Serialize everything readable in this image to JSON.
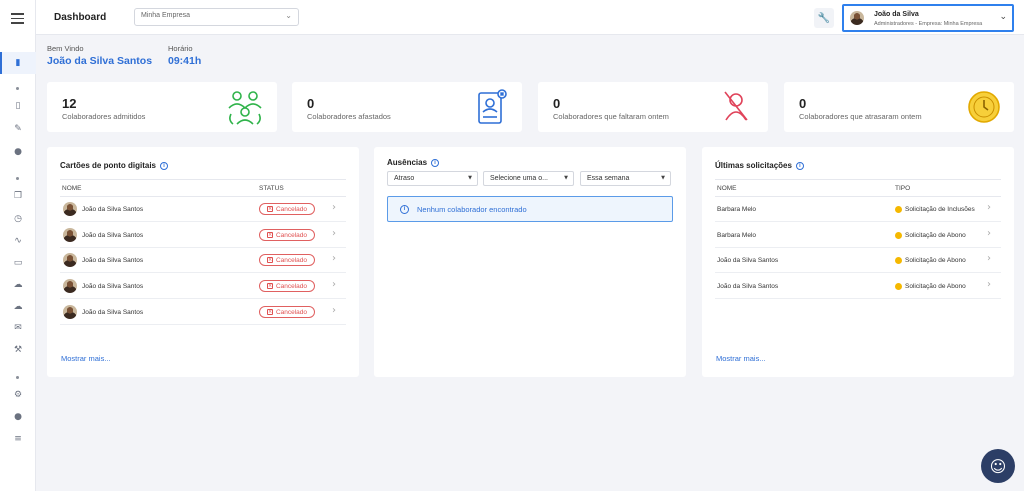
{
  "header": {
    "title": "Dashboard",
    "company_value": "Minha Empresa",
    "user": {
      "name": "João da Silva",
      "role": "Administradores - Empresa: Minha Empresa"
    }
  },
  "welcome": {
    "label": "Bem Vindo",
    "name": "João da Silva Santos",
    "hour_label": "Horário",
    "hour": "09:41h"
  },
  "stats": [
    {
      "value": "12",
      "label": "Colaboradores admitidos",
      "icon": "team-icon"
    },
    {
      "value": "0",
      "label": "Colaboradores afastados",
      "icon": "id-badge-icon"
    },
    {
      "value": "0",
      "label": "Colaboradores que faltaram ontem",
      "icon": "user-remove-icon"
    },
    {
      "value": "0",
      "label": "Colaboradores que atrasaram ontem",
      "icon": "clock-icon"
    }
  ],
  "timecards": {
    "title": "Cartões de ponto digitais",
    "col_name": "NOME",
    "col_status": "STATUS",
    "rows": [
      {
        "name": "João da Silva Santos",
        "status": "Cancelado"
      },
      {
        "name": "João da Silva Santos",
        "status": "Cancelado"
      },
      {
        "name": "João da Silva Santos",
        "status": "Cancelado"
      },
      {
        "name": "João da Silva Santos",
        "status": "Cancelado"
      },
      {
        "name": "João da Silva Santos",
        "status": "Cancelado"
      }
    ],
    "more": "Mostrar mais..."
  },
  "absences": {
    "title": "Ausências",
    "filter_type": "Atraso",
    "filter_option": "Selecione uma o...",
    "filter_period": "Essa semana",
    "empty": "Nenhum colaborador encontrado"
  },
  "requests": {
    "title": "Últimas solicitações",
    "col_name": "NOME",
    "col_type": "TIPO",
    "rows": [
      {
        "name": "Barbara Melo",
        "type": "Solicitação de Inclusões"
      },
      {
        "name": "Barbara Melo",
        "type": "Solicitação de Abono"
      },
      {
        "name": "João da Silva Santos",
        "type": "Solicitação de Abono"
      },
      {
        "name": "João da Silva Santos",
        "type": "Solicitação de Abono"
      }
    ],
    "more": "Mostrar mais..."
  },
  "colors": {
    "accent": "#2f6fd6",
    "danger": "#e05050",
    "warning": "#f5b800",
    "success": "#2fb34a"
  }
}
